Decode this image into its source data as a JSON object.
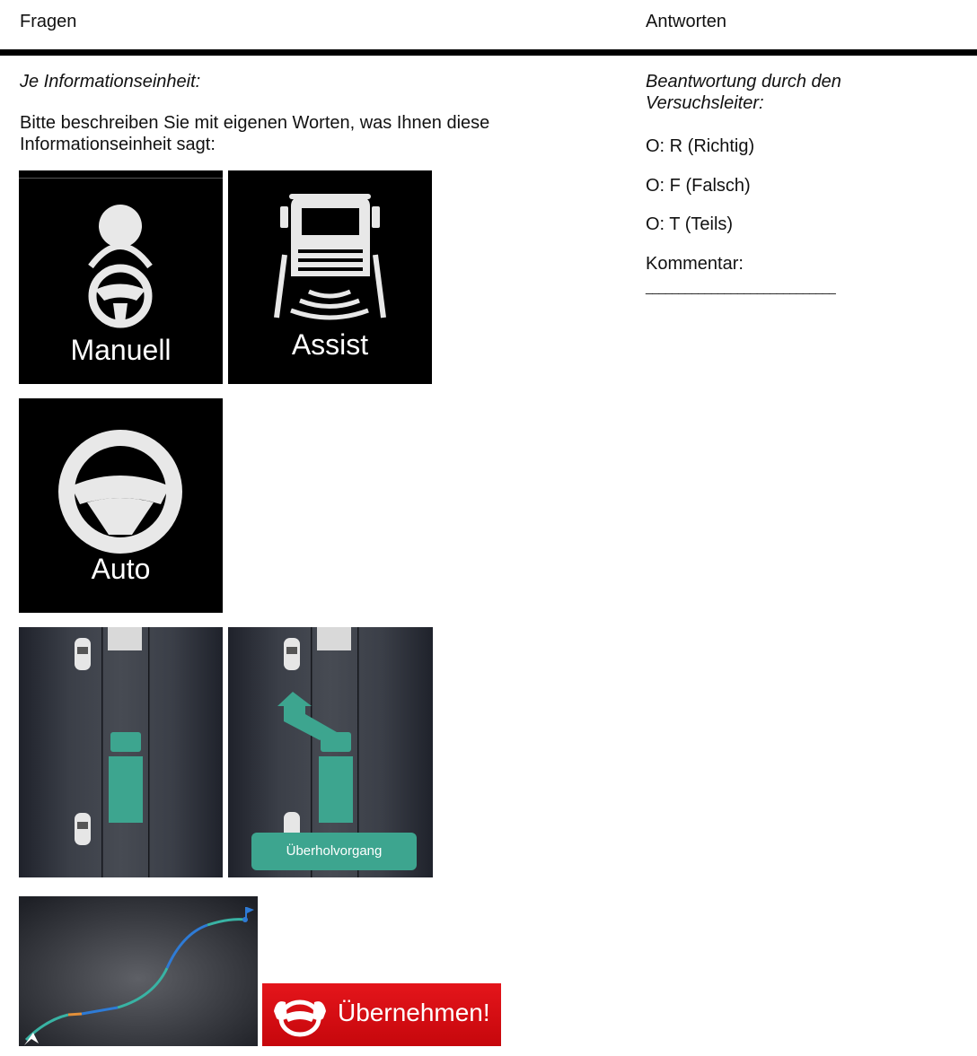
{
  "header": {
    "questions_label": "Fragen",
    "answers_label": "Antworten"
  },
  "questions": {
    "intro_italic": "Je Informationseinheit:",
    "prompt": "Bitte beschreiben Sie mit eigenen Worten, was Ihnen diese Informationseinheit sagt:"
  },
  "mode_icons": {
    "manual": "Manuell",
    "assist": "Assist",
    "auto": "Auto"
  },
  "overtake_button": "Überholvorgang",
  "takeover_alert": {
    "label": "Übernehmen!",
    "icon": "hands-on-wheel-icon",
    "color": "#e01016"
  },
  "answers": {
    "intro_italic": "Beantwortung durch den Versuchsleiter:",
    "options": [
      "O: R (Richtig)",
      "O: F (Falsch)",
      "O: T (Teils)"
    ],
    "comment_label": "Kommentar:",
    "comment_line": "_____________________________"
  },
  "colors": {
    "accent_teal": "#3da58f",
    "route_blue": "#2e7bd6",
    "route_orange": "#e3903a"
  }
}
